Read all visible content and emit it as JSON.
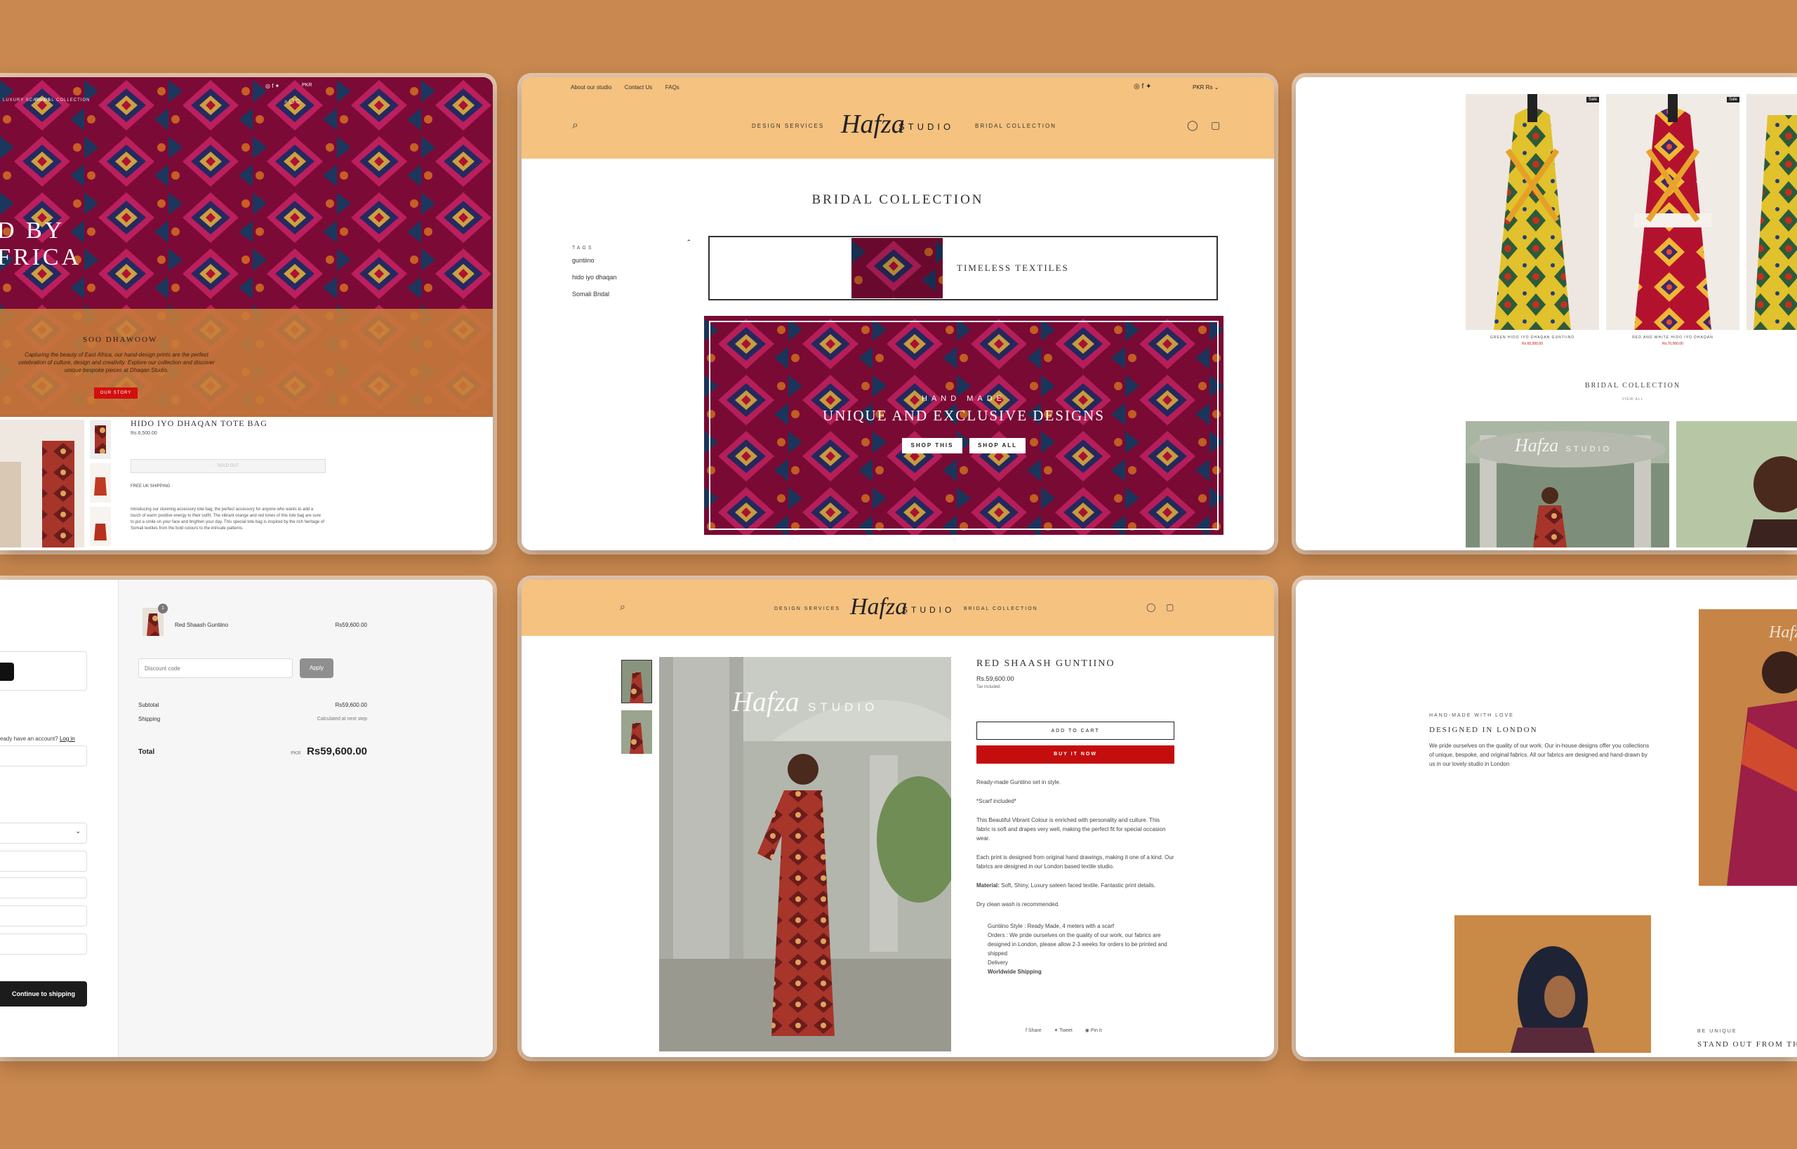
{
  "top_left": {
    "nav_left": "LUXURY SCARVES",
    "nav_right": "BRIDAL COLLECTION",
    "currency": "PKR",
    "hero_line1": "D BY",
    "hero_line2": "FRICA",
    "section_title": "SOO DHAWOOW",
    "section_text": "Capturing the beauty of East Africa, our hand-design prints are the perfect celebration of culture, design and creativity. Explore our collection and discover unique bespoke pieces at Dhaqan Studio.",
    "cta": "OUR STORY",
    "product_title": "HIDO IYO DHAQAN TOTE BAG",
    "product_price": "Rs.6,500.00",
    "sold_out": "SOLD OUT",
    "shipping": "FREE UK SHIPPING",
    "description": "Introducing our stunning accessory tote bag, the perfect accessory for anyone who wants to add a touch of warm positive energy to their outfit. The vibrant orange and red tones of this tote bag are sure to put a smile on your face and brighten your day. This special tote bag is inspired by the rich heritage of Somali textiles from the bold colours to the intricate patterns."
  },
  "top_middle": {
    "util_links": [
      "About our studio",
      "Contact Us",
      "FAQs"
    ],
    "currency": "PKR Rs",
    "nav_left": "DESIGN SERVICES",
    "logo_script": "Hafza",
    "logo_word": "STUDIO",
    "nav_right": "BRIDAL COLLECTION",
    "page_title": "BRIDAL COLLECTION",
    "tags_label": "TAGS",
    "tags": [
      "guntiino",
      "hido iyo dhaqan",
      "Somali Bridal"
    ],
    "timeless": "TIMELESS TEXTILES",
    "hero_kicker": "HAND MADE",
    "hero_heading": "UNIQUE AND EXCLUSIVE DESIGNS",
    "shop_this": "SHOP THIS",
    "shop_all": "SHOP ALL"
  },
  "top_right": {
    "sale1": "Sale",
    "sale2": "Sale",
    "product1": "GREEN HIDO IYO DHAQAN GUNTIINO",
    "product1_price": "Rs.65,000.00",
    "product2": "RED AND WHITE HIDO IYO DHAQAN",
    "product2_price": "Rs.70,000.00",
    "collection_title": "BRIDAL COLLECTION",
    "view_all": "VIEW ALL",
    "banner_script": "Hafza",
    "banner_word": "STUDIO"
  },
  "bottom_left": {
    "item_name": "Red Shaash Guntiino",
    "item_qty": "1",
    "item_price": "Rs59,600.00",
    "discount_placeholder": "Discount code",
    "apply": "Apply",
    "subtotal_label": "Subtotal",
    "subtotal_value": "Rs59,600.00",
    "shipping_label": "Shipping",
    "shipping_value": "Calculated at next step",
    "total_label": "Total",
    "total_currency": "PKR",
    "total_value": "Rs59,600.00",
    "account_text": "eady have an account?",
    "login": "Log in",
    "continue": "Continue to shipping"
  },
  "bottom_middle": {
    "nav_left": "DESIGN SERVICES",
    "logo_script": "Hafza",
    "logo_word": "STUDIO",
    "nav_right": "BRIDAL COLLECTION",
    "watermark_script": "Hafza",
    "watermark_word": "STUDIO",
    "product_title": "RED SHAASH GUNTIINO",
    "price": "Rs.59,600.00",
    "tax": "Tax included.",
    "add_to_cart": "ADD TO CART",
    "buy_now": "BUY IT NOW",
    "p1": "Ready-made Guntiino set in style.",
    "p2": "*Scarf included*",
    "p3": "This Beautiful Vibrant Colour is enriched with personality and culture. This fabric is soft and drapes very well, making the perfect fit for special occasion wear.",
    "p4": "Each print is designed from original hand drawings, making it one of a kind. Our fabrics are designed in our London based textile studio.",
    "material_label": "Material:",
    "material_text": "Soft, Shiny, Luxury sateen faced textile. Fantastic print details.",
    "p6": "Dry clean wash is recommended.",
    "b1": "Guntiino Style : Ready Made, 4 meters with a scarf",
    "b2": "Orders : We pride ourselves on the quality of our work, our fabrics are designed in London, please allow 2-3 weeks for orders to be printed and shipped",
    "b3": "Delivery",
    "b4": "Worldwide Shipping",
    "share": "Share",
    "tweet": "Tweet",
    "pin": "Pin it"
  },
  "bottom_right": {
    "kicker": "HAND-MADE WITH LOVE",
    "heading": "DESIGNED IN LONDON",
    "text": "We pride ourselves on the quality of our work. Our in-house designs offer you collections of unique, bespoke, and original fabrics. All our fabrics are designed and hand-drawn by us in our lovely studio in London",
    "photo_script": "Hafza",
    "kicker2": "BE UNIQUE",
    "heading2": "STAND OUT FROM TH"
  },
  "colors": {
    "background": "#c8884f",
    "header": "#f5c27f",
    "accent_red": "#c40d0d",
    "fabric_magenta": "#b0124a"
  }
}
